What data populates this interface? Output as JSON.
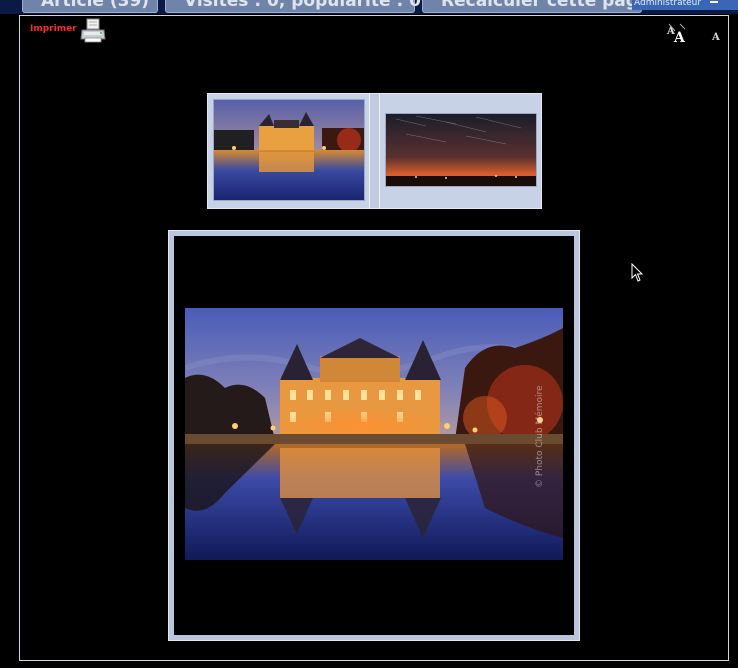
{
  "tabs": [
    {
      "label": "Article (39)"
    },
    {
      "label": "Visites : 0, popularité : 0"
    },
    {
      "label": "Recalculer cette page"
    }
  ],
  "admin": {
    "label": "Administrateur"
  },
  "toolbar": {
    "print_label": "Imprimer",
    "print_icon": "printer-icon",
    "text_size_icon": "text-size-icon",
    "small_text_label": "A"
  },
  "gallery": {
    "thumbnails": [
      {
        "subject": "castle-night-reflection"
      },
      {
        "subject": "star-trails-horizon"
      }
    ],
    "main_image": {
      "subject": "castle-night-reflection",
      "watermark": "© Photo Club Mémoire"
    }
  },
  "colors": {
    "background": "#000000",
    "tab": "#6f84a8",
    "tab_strip": "#0a1a44",
    "admin_bar": "#3a66b8",
    "print_link": "#ff2a2a",
    "thumb_panel": "#c8d2e6",
    "image_frame": "#b9c6dc"
  }
}
